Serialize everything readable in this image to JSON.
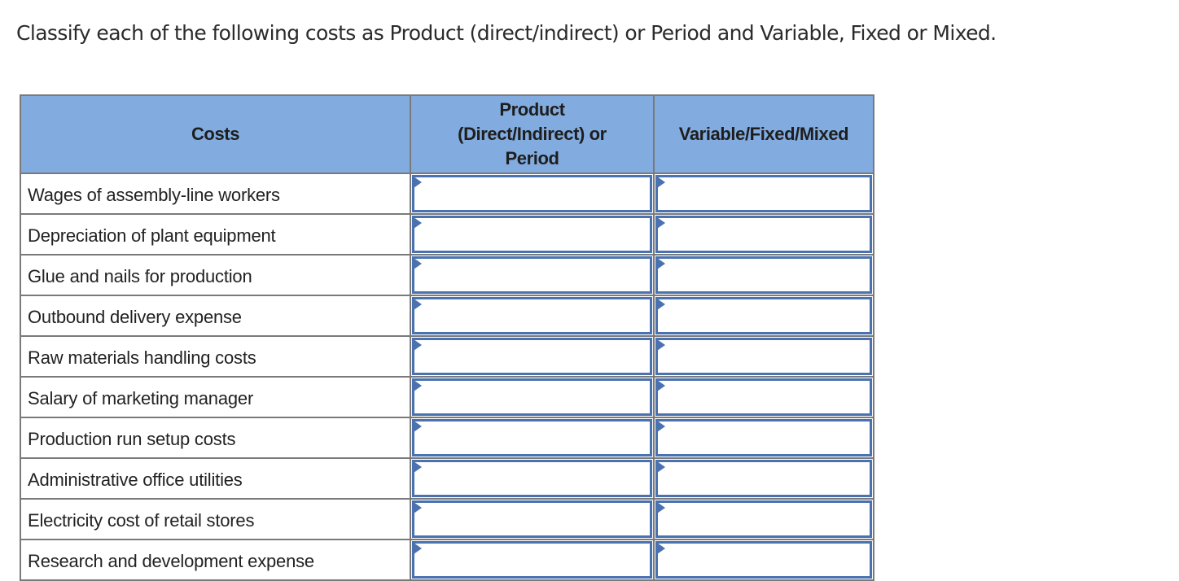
{
  "question": {
    "text": "Classify each of the following costs as Product (direct/indirect) or Period and Variable, Fixed or Mixed."
  },
  "table": {
    "headers": {
      "costs": "Costs",
      "product_period": "Product (Direct/Indirect) or Period",
      "variable_fixed_mixed": "Variable/Fixed/Mixed"
    },
    "rows": [
      {
        "cost": "Wages of assembly-line workers",
        "product_period": "",
        "variable_fixed_mixed": ""
      },
      {
        "cost": "Depreciation of plant equipment",
        "product_period": "",
        "variable_fixed_mixed": ""
      },
      {
        "cost": "Glue and nails for production",
        "product_period": "",
        "variable_fixed_mixed": ""
      },
      {
        "cost": "Outbound delivery expense",
        "product_period": "",
        "variable_fixed_mixed": ""
      },
      {
        "cost": "Raw materials handling costs",
        "product_period": "",
        "variable_fixed_mixed": ""
      },
      {
        "cost": "Salary of marketing manager",
        "product_period": "",
        "variable_fixed_mixed": ""
      },
      {
        "cost": "Production run setup costs",
        "product_period": "",
        "variable_fixed_mixed": ""
      },
      {
        "cost": "Administrative office utilities",
        "product_period": "",
        "variable_fixed_mixed": ""
      },
      {
        "cost": "Electricity cost of retail stores",
        "product_period": "",
        "variable_fixed_mixed": ""
      },
      {
        "cost": "Research and development expense",
        "product_period": "",
        "variable_fixed_mixed": ""
      }
    ]
  },
  "colors": {
    "header_bg": "#82abdf",
    "input_border": "#4a72b0",
    "grid_border": "#7a7a7a"
  },
  "icons": {
    "cell_marker": "dropdown-marker-icon"
  }
}
